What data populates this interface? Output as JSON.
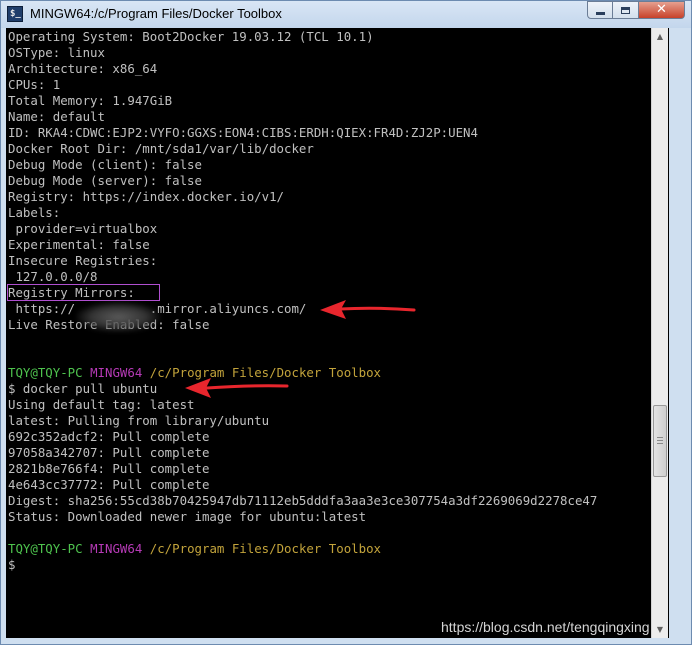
{
  "window": {
    "title": "MINGW64:/c/Program Files/Docker Toolbox",
    "app_icon_glyph": "$_",
    "buttons": {
      "minimize": "minimize",
      "maximize": "maximize",
      "close": "✕"
    }
  },
  "terminal": {
    "info_lines": [
      "Operating System: Boot2Docker 19.03.12 (TCL 10.1)",
      "OSType: linux",
      "Architecture: x86_64",
      "CPUs: 1",
      "Total Memory: 1.947GiB",
      "Name: default",
      "ID: RKA4:CDWC:EJP2:VYFO:GGXS:EON4:CIBS:ERDH:QIEX:FR4D:ZJ2P:UEN4",
      "Docker Root Dir: /mnt/sda1/var/lib/docker",
      "Debug Mode (client): false",
      "Debug Mode (server): false",
      "Registry: https://index.docker.io/v1/",
      "Labels:",
      " provider=virtualbox",
      "Experimental: false",
      "Insecure Registries:",
      " 127.0.0.0/8",
      "Registry Mirrors:",
      " https://          .mirror.aliyuncs.com/",
      "Live Restore Enabled: false"
    ],
    "prompt1": {
      "user": "TQY@TQY-PC",
      "host": "MINGW64",
      "path": "/c/Program Files/Docker Toolbox"
    },
    "command": "$ docker pull ubuntu",
    "pull_lines": [
      "Using default tag: latest",
      "latest: Pulling from library/ubuntu",
      "692c352adcf2: Pull complete",
      "97058a342707: Pull complete",
      "2821b8e766f4: Pull complete",
      "4e643cc37772: Pull complete",
      "Digest: sha256:55cd38b70425947db71112eb5dddfa3aa3e3ce307754a3df2269069d2278ce47",
      "Status: Downloaded newer image for ubuntu:latest"
    ],
    "prompt2": {
      "user": "TQY@TQY-PC",
      "host": "MINGW64",
      "path": "/c/Program Files/Docker Toolbox"
    },
    "cursor_line": "$"
  },
  "colors": {
    "prompt_user": "#4ec34e",
    "prompt_host": "#b63ab6",
    "prompt_path": "#c2a33b",
    "annotation": "#e8262d"
  },
  "watermark": "https://blog.csdn.net/tengqingxing"
}
